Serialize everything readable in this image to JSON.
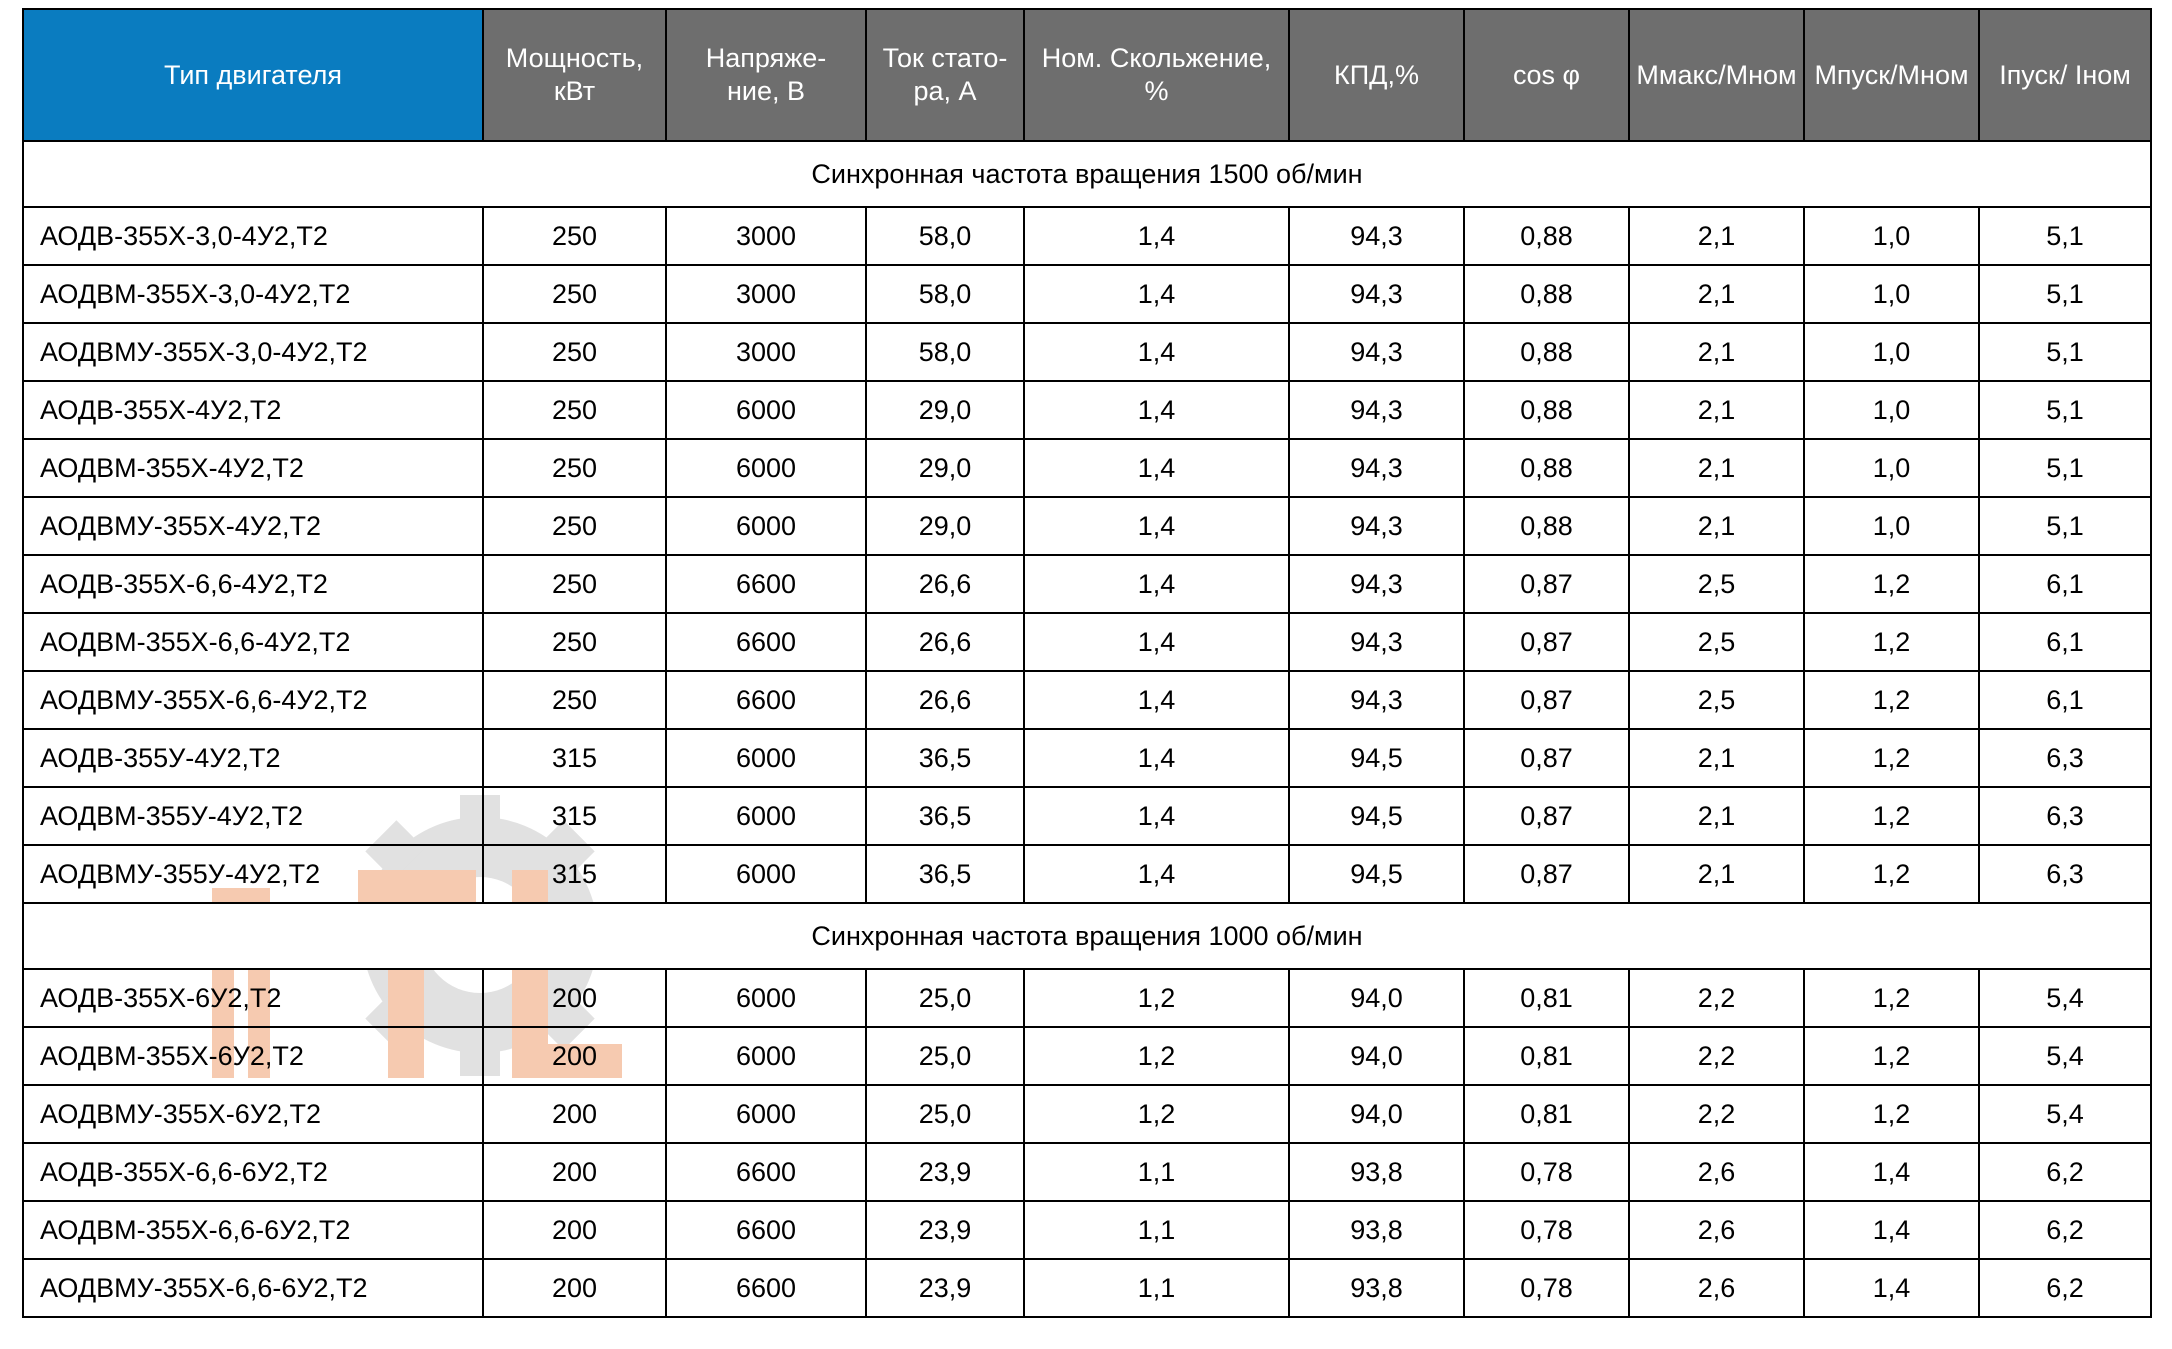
{
  "colors": {
    "header_accent": "#0a7cc0",
    "header_gray": "#6e6e6e",
    "border": "#000000",
    "watermark_orange": "#f0a070",
    "watermark_gray": "#c9c9c9"
  },
  "table": {
    "columns": [
      {
        "key": "type",
        "label": "Тип двигателя",
        "accent": true
      },
      {
        "key": "power",
        "label": "Мощность,\nкВт",
        "accent": false
      },
      {
        "key": "volt",
        "label": "Напряже-\nние, В",
        "accent": false
      },
      {
        "key": "cur",
        "label": "Ток стато-\nра, А",
        "accent": false
      },
      {
        "key": "slip",
        "label": "Ном. Скольжение,\n%",
        "accent": false
      },
      {
        "key": "eff",
        "label": "КПД,%",
        "accent": false
      },
      {
        "key": "cos",
        "label": "cos φ",
        "accent": false
      },
      {
        "key": "mmax",
        "label": "Ммакс/Мном",
        "accent": false
      },
      {
        "key": "mstart",
        "label": "Мпуск/Мном",
        "accent": false
      },
      {
        "key": "istart",
        "label": "Iпуск/ Iном",
        "accent": false
      }
    ],
    "sections": [
      {
        "title": "Синхронная частота вращения 1500 об/мин",
        "rows": [
          [
            "АОДВ-355Х-3,0-4У2,Т2",
            "250",
            "3000",
            "58,0",
            "1,4",
            "94,3",
            "0,88",
            "2,1",
            "1,0",
            "5,1"
          ],
          [
            "АОДВМ-355Х-3,0-4У2,Т2",
            "250",
            "3000",
            "58,0",
            "1,4",
            "94,3",
            "0,88",
            "2,1",
            "1,0",
            "5,1"
          ],
          [
            "АОДВМУ-355Х-3,0-4У2,Т2",
            "250",
            "3000",
            "58,0",
            "1,4",
            "94,3",
            "0,88",
            "2,1",
            "1,0",
            "5,1"
          ],
          [
            "АОДВ-355Х-4У2,Т2",
            "250",
            "6000",
            "29,0",
            "1,4",
            "94,3",
            "0,88",
            "2,1",
            "1,0",
            "5,1"
          ],
          [
            "АОДВМ-355Х-4У2,Т2",
            "250",
            "6000",
            "29,0",
            "1,4",
            "94,3",
            "0,88",
            "2,1",
            "1,0",
            "5,1"
          ],
          [
            "АОДВМУ-355Х-4У2,Т2",
            "250",
            "6000",
            "29,0",
            "1,4",
            "94,3",
            "0,88",
            "2,1",
            "1,0",
            "5,1"
          ],
          [
            "АОДВ-355Х-6,6-4У2,Т2",
            "250",
            "6600",
            "26,6",
            "1,4",
            "94,3",
            "0,87",
            "2,5",
            "1,2",
            "6,1"
          ],
          [
            "АОДВМ-355Х-6,6-4У2,Т2",
            "250",
            "6600",
            "26,6",
            "1,4",
            "94,3",
            "0,87",
            "2,5",
            "1,2",
            "6,1"
          ],
          [
            "АОДВМУ-355Х-6,6-4У2,Т2",
            "250",
            "6600",
            "26,6",
            "1,4",
            "94,3",
            "0,87",
            "2,5",
            "1,2",
            "6,1"
          ],
          [
            "АОДВ-355У-4У2,Т2",
            "315",
            "6000",
            "36,5",
            "1,4",
            "94,5",
            "0,87",
            "2,1",
            "1,2",
            "6,3"
          ],
          [
            "АОДВМ-355У-4У2,Т2",
            "315",
            "6000",
            "36,5",
            "1,4",
            "94,5",
            "0,87",
            "2,1",
            "1,2",
            "6,3"
          ],
          [
            "АОДВМУ-355У-4У2,Т2",
            "315",
            "6000",
            "36,5",
            "1,4",
            "94,5",
            "0,87",
            "2,1",
            "1,2",
            "6,3"
          ]
        ]
      },
      {
        "title": "Синхронная частота вращения 1000 об/мин",
        "rows": [
          [
            "АОДВ-355Х-6У2,Т2",
            "200",
            "6000",
            "25,0",
            "1,2",
            "94,0",
            "0,81",
            "2,2",
            "1,2",
            "5,4"
          ],
          [
            "АОДВМ-355Х-6У2,Т2",
            "200",
            "6000",
            "25,0",
            "1,2",
            "94,0",
            "0,81",
            "2,2",
            "1,2",
            "5,4"
          ],
          [
            "АОДВМУ-355Х-6У2,Т2",
            "200",
            "6000",
            "25,0",
            "1,2",
            "94,0",
            "0,81",
            "2,2",
            "1,2",
            "5,4"
          ],
          [
            "АОДВ-355Х-6,6-6У2,Т2",
            "200",
            "6600",
            "23,9",
            "1,1",
            "93,8",
            "0,78",
            "2,6",
            "1,4",
            "6,2"
          ],
          [
            "АОДВМ-355Х-6,6-6У2,Т2",
            "200",
            "6600",
            "23,9",
            "1,1",
            "93,8",
            "0,78",
            "2,6",
            "1,4",
            "6,2"
          ],
          [
            "АОДВМУ-355Х-6,6-6У2,Т2",
            "200",
            "6600",
            "23,9",
            "1,1",
            "93,8",
            "0,78",
            "2,6",
            "1,4",
            "6,2"
          ]
        ]
      }
    ]
  }
}
